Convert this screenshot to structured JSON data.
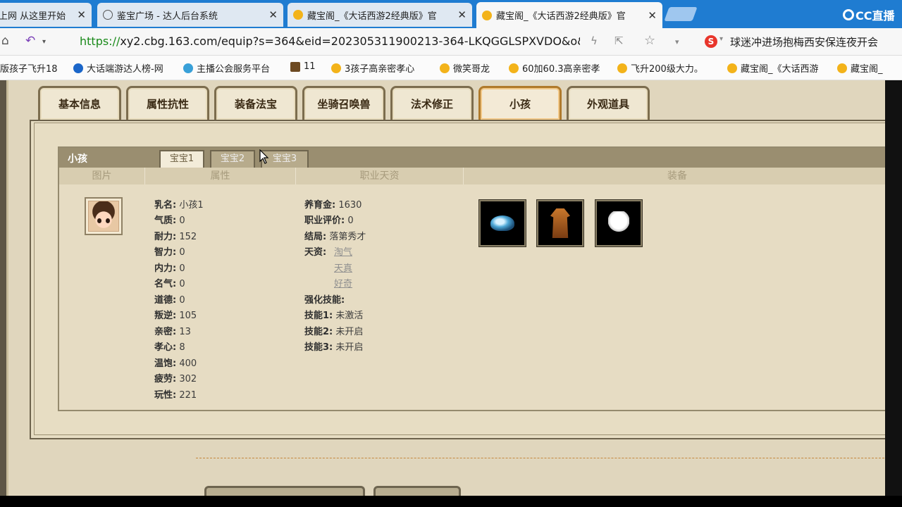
{
  "browser": {
    "tabs": [
      {
        "title": "上网 从这里开始"
      },
      {
        "title": "鉴宝广场 - 达人后台系统"
      },
      {
        "title": "藏宝阁_《大话西游2经典版》官"
      },
      {
        "title": "藏宝阁_《大话西游2经典版》官"
      }
    ],
    "brand": "CC直播",
    "url_scheme": "https://",
    "url_rest": "xy2.cbg.163.com/equip?s=364&eid=202305311900213-364-LKQGGLSPXVDO&o&",
    "search_text": "球迷冲进场抱梅西安保连夜开会",
    "bookmarks": [
      "版孩子飞升18",
      "大话端游达人榜-网",
      "主播公会服务平台",
      "11",
      "3孩子高亲密孝心",
      "微笑哥龙",
      "60加60.3高亲密孝",
      "飞升200级大力。",
      "藏宝阁_《大话西游",
      "藏宝阁_"
    ]
  },
  "main_tabs": [
    "基本信息",
    "属性抗性",
    "装备法宝",
    "坐骑召唤兽",
    "法术修正",
    "小孩",
    "外观道具"
  ],
  "section": {
    "title": "小孩",
    "sub_tabs": [
      "宝宝1",
      "宝宝2",
      "宝宝3"
    ],
    "columns": [
      "图片",
      "属性",
      "职业天资",
      "装备"
    ]
  },
  "attributes": [
    {
      "label": "乳名:",
      "value": "小孩1"
    },
    {
      "label": "气质:",
      "value": "0"
    },
    {
      "label": "耐力:",
      "value": "152"
    },
    {
      "label": "智力:",
      "value": "0"
    },
    {
      "label": "内力:",
      "value": "0"
    },
    {
      "label": "名气:",
      "value": "0"
    },
    {
      "label": "道德:",
      "value": "0"
    },
    {
      "label": "叛逆:",
      "value": "105"
    },
    {
      "label": "亲密:",
      "value": "13"
    },
    {
      "label": "孝心:",
      "value": "8"
    },
    {
      "label": "温饱:",
      "value": "400"
    },
    {
      "label": "疲劳:",
      "value": "302"
    },
    {
      "label": "玩性:",
      "value": "221"
    }
  ],
  "career": {
    "rows": [
      {
        "label": "养育金:",
        "value": "1630"
      },
      {
        "label": "职业评价:",
        "value": "0"
      },
      {
        "label": "结局:",
        "value": "落第秀才"
      }
    ],
    "talent_label": "天资:",
    "talents": [
      "淘气",
      "天真",
      "好奇"
    ],
    "skills_label": "强化技能:",
    "skills": [
      {
        "label": "技能1:",
        "value": "未激活"
      },
      {
        "label": "技能2:",
        "value": "未开启"
      },
      {
        "label": "技能3:",
        "value": "未开启"
      }
    ]
  },
  "equipment_icons": [
    "helmet-icon",
    "robe-icon",
    "fan-icon"
  ]
}
